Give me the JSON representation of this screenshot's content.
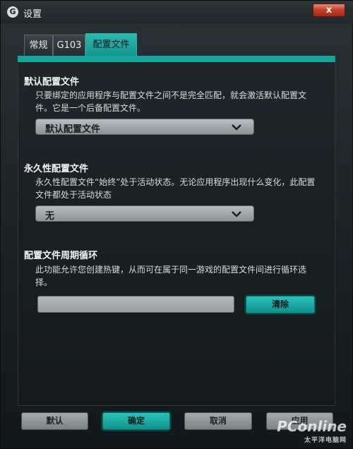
{
  "window": {
    "title": "设置",
    "close_label": "x"
  },
  "tabs": [
    {
      "label": "常规",
      "active": false
    },
    {
      "label": "G103",
      "active": false
    },
    {
      "label": "配置文件",
      "active": true
    }
  ],
  "default_profile": {
    "title": "默认配置文件",
    "description": "只要绑定的应用程序与配置文件之间不是完全匹配，就会激活默认配置文件。它是一个后备配置文件。",
    "selected": "默认配置文件"
  },
  "persistent_profile": {
    "title": "永久性配置文件",
    "description": "永久性配置文件“始终”处于活动状态。无论应用程序出现什么变化，此配置文件都处于活动状态",
    "selected": "无"
  },
  "profile_cycle": {
    "title": "配置文件周期循环",
    "description": "此功能允许您创建热键，从而可在属于同一游戏的配置文件间进行循环选择。",
    "hotkey_value": "",
    "clear_label": "清除"
  },
  "footer": {
    "default_label": "默认",
    "ok_label": "确定",
    "cancel_label": "取消",
    "apply_label": "应用"
  },
  "watermark": {
    "logo": "PConline",
    "subtitle": "太平洋电脑网"
  },
  "colors": {
    "accent": "#16a39c",
    "close_red": "#c8402b"
  }
}
